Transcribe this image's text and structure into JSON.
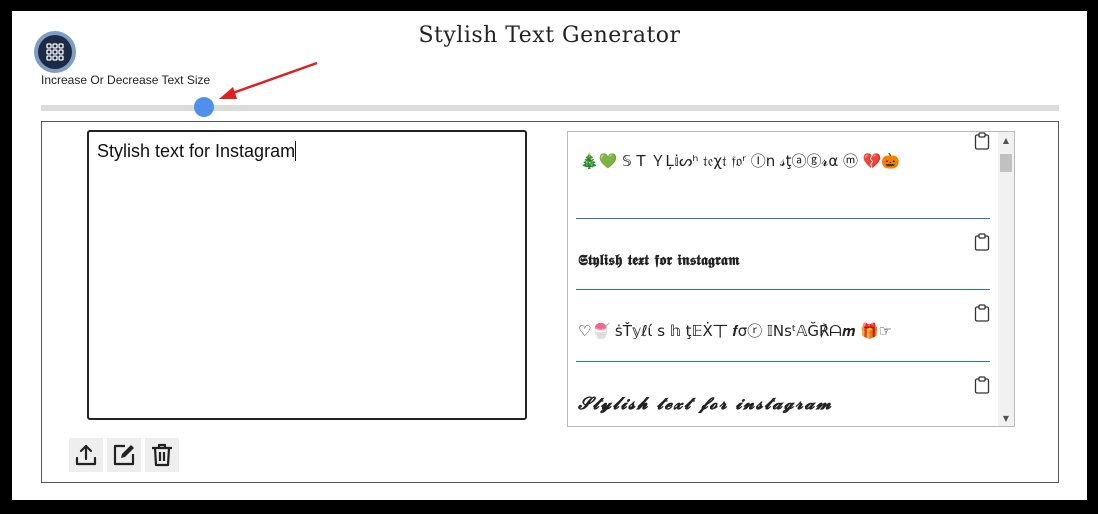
{
  "header": {
    "title": "Stylish Text Generator",
    "apps_icon": "apps-grid-icon"
  },
  "size_control": {
    "label": "Increase Or Decrease Text Size",
    "slider_value_fraction": 0.16
  },
  "editor": {
    "text": "Stylish text for Instagram"
  },
  "toolbar": {
    "icons": [
      "upload-icon",
      "edit-icon",
      "trash-icon"
    ]
  },
  "results": [
    {
      "text": "🎄💚  𝕊 T ＹĻ𝕚ᔕʰ 𝔱𝔢χ𝔱 𝔣𝔬ʳ Ⓘn 𝓈ţⓐⓖ𝓻α ⓜ  💔🎃"
    },
    {
      "text": "𝕾𝖙𝖞𝖑𝖎𝖘𝖍 𝖙𝖊𝖝𝖙 𝖋𝖔𝖗 𝖎𝖓𝖘𝖙𝖆𝖌𝖗𝖆𝖒"
    },
    {
      "text": "♡🍧  ṡŤ𝕪ℓί s 𝕙 ţ𝔼Ẋ丅  𝒇σⓡ  𝕀Nsᵗ𝔸Ğ℟ᗩ𝒎  🎁☞"
    },
    {
      "text": "𝓢𝓽𝔂𝓵𝓲𝓼𝓱 𝓽𝓮𝔁𝓽 𝓯𝓸𝓻 𝓲𝓷𝓼𝓽𝓪𝓰𝓻𝓪𝓶"
    }
  ],
  "colors": {
    "slider_thumb": "#4f90ef",
    "slider_track": "#dcdcdc",
    "divider": "#2f6fb8",
    "annotation_arrow": "#e02020"
  }
}
